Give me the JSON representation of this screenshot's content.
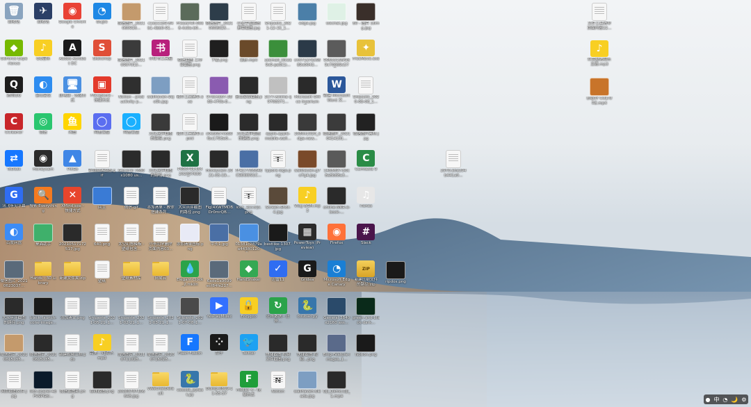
{
  "desktop": {
    "tray": [
      "●",
      "中",
      "◔",
      "🌙",
      "⚙"
    ],
    "icons": [
      {
        "label": "回收站",
        "color": "#8aa4bf",
        "glyph": "🗑",
        "kind": "app"
      },
      {
        "label": "回收站",
        "color": "#2b3f66",
        "glyph": "✈",
        "kind": "app"
      },
      {
        "label": "Google Chrome",
        "color": "#e94235",
        "glyph": "◉",
        "kind": "app"
      },
      {
        "label": "Bugle",
        "color": "#1e88e5",
        "glyph": "◔",
        "kind": "app"
      },
      {
        "label": "微信图片_2021060916...",
        "color": "#c49a6c",
        "glyph": "",
        "kind": "img"
      },
      {
        "label": "c1ea11b9-84b1-4bb0-91...",
        "color": "#f4f4f4",
        "glyph": "",
        "kind": "doc"
      },
      {
        "label": "Freeze!Dl-00e8-4c0e-b0...",
        "color": "#5b6b5a",
        "glyph": "",
        "kind": "img"
      },
      {
        "label": "微信图片_20210608025...",
        "color": "#2d3d4a",
        "glyph": "",
        "kind": "img"
      },
      {
        "label": "小米手机截图 屏幕截图.jpg",
        "color": "#f4f4f4",
        "glyph": "",
        "kind": "doc"
      },
      {
        "label": "Snipaste_2021-12-15_1...",
        "color": "#f0f0f0",
        "glyph": "",
        "kind": "doc"
      },
      {
        "label": "edge.jpg",
        "color": "#4b7fa8",
        "glyph": "",
        "kind": "img"
      },
      {
        "label": "wechat.jpg",
        "color": "#dff1e6",
        "glyph": "",
        "kind": "img"
      },
      {
        "label": "80 - 图片 (dimg.jpg",
        "color": "#3a2f2a",
        "glyph": "",
        "kind": "img"
      },
      {
        "label": "GeForce Experience",
        "color": "#76b900",
        "glyph": "◆",
        "kind": "app"
      },
      {
        "label": "QQ音乐",
        "color": "#f8cf23",
        "glyph": "♪",
        "kind": "app"
      },
      {
        "label": "Adobe Acrobat DC",
        "color": "#1a1a1a",
        "glyph": "A",
        "kind": "app"
      },
      {
        "label": "SketchUp",
        "color": "#e04f38",
        "glyph": "S",
        "kind": "app"
      },
      {
        "label": "微信图片_20210907015...",
        "color": "#3b3b3b",
        "glyph": "",
        "kind": "img"
      },
      {
        "label": "小红书工具箱",
        "color": "#b8207c",
        "glyph": "书",
        "kind": "app"
      },
      {
        "label": "微信截图 工作台截图.png",
        "color": "#f4f4f4",
        "glyph": "",
        "kind": "doc"
      },
      {
        "label": "下载.png",
        "color": "#1f1f1f",
        "glyph": "",
        "kind": "img"
      },
      {
        "label": "录屏.mp4",
        "color": "#6a4a2a",
        "glyph": "",
        "kind": "img"
      },
      {
        "label": "usemail_lkk3a9c9-pa0(1)...",
        "color": "#3b8f3b",
        "glyph": "",
        "kind": "img"
      },
      {
        "label": "c4471a7ac6889c0043...",
        "color": "#2b3a48",
        "glyph": "",
        "kind": "img"
      },
      {
        "label": "90653158f9d9c70089c573...",
        "color": "#5b5b5b",
        "glyph": "",
        "kind": "img"
      },
      {
        "label": "FreeMove.exe",
        "color": "#e8c23a",
        "glyph": "✦",
        "kind": "app"
      },
      {
        "label": "腾讯QQ",
        "color": "#1d1d1d",
        "glyph": "Q",
        "kind": "app"
      },
      {
        "label": "金山会议",
        "color": "#2d8cf0",
        "glyph": "◐",
        "kind": "app"
      },
      {
        "label": "此电脑 - 快捷方式",
        "color": "#4a90e2",
        "glyph": "🖥",
        "kind": "app"
      },
      {
        "label": "FSCapture - 快捷方式",
        "color": "#e33a2b",
        "glyph": "▣",
        "kind": "app"
      },
      {
        "label": "Notion - productivity p...",
        "color": "#2f2f2f",
        "glyph": "",
        "kind": "img"
      },
      {
        "label": "wallhaven-9ejo9k.jpg",
        "color": "#7d9ec2",
        "glyph": "",
        "kind": "img"
      },
      {
        "label": "软件工具清单.exe",
        "color": "#f4f4f4",
        "glyph": "",
        "kind": "doc"
      },
      {
        "label": "97dc4a67-3888-470b-8...",
        "color": "#8a5bb0",
        "glyph": "",
        "kind": "img"
      },
      {
        "label": "金山会议截图.png",
        "color": "#2a2a2a",
        "glyph": "",
        "kind": "img"
      },
      {
        "label": "3c77-Anima q9708371...",
        "color": "#c0c0c0",
        "glyph": "",
        "kind": "img"
      },
      {
        "label": "Microsoft Office Inserium 6...",
        "color": "#2a2a2a",
        "glyph": "",
        "kind": "img"
      },
      {
        "label": "新建 Microsoft Word 文...",
        "color": "#2b579a",
        "glyph": "W",
        "kind": "app"
      },
      {
        "label": "Snipaste_2020-08-08_1...",
        "color": "#f0f0f0",
        "glyph": "",
        "kind": "doc"
      },
      {
        "label": "CCleaner",
        "color": "#c8262a",
        "glyph": "C",
        "kind": "app"
      },
      {
        "label": "微信",
        "color": "#2ac66f",
        "glyph": "◎",
        "kind": "app"
      },
      {
        "label": "闲鱼",
        "color": "#ffd500",
        "glyph": "鱼",
        "kind": "app"
      },
      {
        "label": "阿里云盘",
        "color": "#5b6ef0",
        "glyph": "◯",
        "kind": "app"
      },
      {
        "label": "阿里云盘",
        "color": "#1ab0ff",
        "glyph": "◯",
        "kind": "app"
      },
      {
        "label": "大众点评截图 的路径.png",
        "color": "#3a3a3a",
        "glyph": "",
        "kind": "img"
      },
      {
        "label": "软件工具清单.xpml",
        "color": "#f4f4f4",
        "glyph": "",
        "kind": "doc"
      },
      {
        "label": "c0ed057c6d0fbc1793e0...",
        "color": "#1a1a1a",
        "glyph": "",
        "kind": "img"
      },
      {
        "label": "大众点评截图 的路径.png",
        "color": "#2b2b2b",
        "glyph": "",
        "kind": "img"
      },
      {
        "label": "apple-apple-mobile-wall...",
        "color": "#2a2a2a",
        "glyph": "",
        "kind": "img"
      },
      {
        "label": "1080x1920_edge-new...",
        "color": "#3a3a3a",
        "glyph": "",
        "kind": "img"
      },
      {
        "label": "微信图片_20210414101...",
        "color": "#3b3b3b",
        "glyph": "",
        "kind": "img"
      },
      {
        "label": "微信图片素材.jpg",
        "color": "#222",
        "glyph": "",
        "kind": "img"
      },
      {
        "label": "ToDesk",
        "color": "#1677ff",
        "glyph": "⇄",
        "kind": "app"
      },
      {
        "label": "Honeycam",
        "color": "#2b2b2b",
        "glyph": "◉",
        "kind": "app"
      },
      {
        "label": "PicGo",
        "color": "#3f86e6",
        "glyph": "▲",
        "kind": "app"
      },
      {
        "label": "新浪微博截图.gif",
        "color": "#f4f4f4",
        "glyph": "",
        "kind": "doc"
      },
      {
        "label": "General 7680x1080 us...",
        "color": "#2b2b2b",
        "glyph": "",
        "kind": "img"
      },
      {
        "label": "大众点评截图 的路径.png",
        "color": "#2a2a2a",
        "glyph": "",
        "kind": "img"
      },
      {
        "label": "P000791434 2028976594...",
        "color": "#1f7244",
        "glyph": "X",
        "kind": "app"
      },
      {
        "label": "Honeycam 2021-03-19...",
        "color": "#2a2a2a",
        "glyph": "",
        "kind": "img"
      },
      {
        "label": "7F4177D5846C9DDD91C...",
        "color": "#4a6fa5",
        "glyph": "",
        "kind": "img"
      },
      {
        "label": "typora logo.png",
        "color": "#f4f4f4",
        "glyph": "T",
        "kind": "doc"
      },
      {
        "label": "wallhaven-g7o7g4.jpg",
        "color": "#7a4a2a",
        "glyph": "",
        "kind": "img"
      },
      {
        "label": "1485897-b0c8a8b88a3...",
        "color": "#5a5a5a",
        "glyph": "",
        "kind": "img"
      },
      {
        "label": "Camtasia 9",
        "color": "#2a8c46",
        "glyph": "C",
        "kind": "app"
      },
      {
        "label": "讯飞听见字幕",
        "color": "#2f6df2",
        "glyph": "G",
        "kind": "app"
      },
      {
        "label": "搜索 Everything",
        "color": "#f47a20",
        "glyph": "🔍",
        "kind": "app"
      },
      {
        "label": "XMind.exe - 快捷方式",
        "color": "#e8452c",
        "glyph": "✕",
        "kind": "app"
      },
      {
        "label": "回主",
        "color": "#3a7bd5",
        "glyph": "",
        "kind": "img"
      },
      {
        "label": "微信.gif",
        "color": "#f4f4f4",
        "glyph": "",
        "kind": "doc"
      },
      {
        "label": "添加清单 - 教你搭建系列...",
        "color": "#f4f4f4",
        "glyph": "",
        "kind": "doc"
      },
      {
        "label": "大众点评截图 的路径.png",
        "color": "#2a2a2a",
        "glyph": "",
        "kind": "img"
      },
      {
        "label": "Fig(4XWTMDBDr0mrQB...",
        "color": "#f4f4f4",
        "glyph": "",
        "kind": "doc"
      },
      {
        "label": "icon_2[3.8]3.png",
        "color": "#e0e0e0",
        "glyph": "T",
        "kind": "doc"
      },
      {
        "label": "Screen-Shot-4.jpg",
        "color": "#5a4a3a",
        "glyph": "",
        "kind": "img"
      },
      {
        "label": "Vlog BGM.mp3",
        "color": "#f8cf23",
        "glyph": "♪",
        "kind": "app"
      },
      {
        "label": "online-MKR-e-book-...",
        "color": "#2a2a2a",
        "glyph": "",
        "kind": "img"
      },
      {
        "label": "iTunes",
        "color": "#e7e7e7",
        "glyph": "♫",
        "kind": "app"
      },
      {
        "label": "百度网盘",
        "color": "#3d8cf5",
        "glyph": "◐",
        "kind": "app"
      },
      {
        "label": "桌面助手",
        "color": "#3fb06b",
        "glyph": "",
        "kind": "img"
      },
      {
        "label": "20210517172517.jpg",
        "color": "#2a2a2a",
        "glyph": "",
        "kind": "img"
      },
      {
        "label": "640.png",
        "color": "#f4f4f4",
        "glyph": "",
        "kind": "doc"
      },
      {
        "label": "太空幻想模板 - 壁纸包含...",
        "color": "#f4f4f4",
        "glyph": "",
        "kind": "doc"
      },
      {
        "label": "小李同学删除 页面内容03...",
        "color": "#f4f4f4",
        "glyph": "",
        "kind": "doc"
      },
      {
        "label": "添加清单图标.png",
        "color": "#e8eaf6",
        "glyph": "",
        "kind": "img"
      },
      {
        "label": "中长1.jpg",
        "color": "#4a6fa5",
        "glyph": "",
        "kind": "img"
      },
      {
        "label": "01381c2879aa443801200...",
        "color": "#4a90e2",
        "glyph": "",
        "kind": "img"
      },
      {
        "label": "bestlike-1307.jpg",
        "color": "#1a1a1a",
        "glyph": "",
        "kind": "img"
      },
      {
        "label": "PowerToys (Preview)",
        "color": "#2b2b2b",
        "glyph": "▦",
        "kind": "app"
      },
      {
        "label": "Firefox",
        "color": "#ff7139",
        "glyph": "◉",
        "kind": "app"
      },
      {
        "label": "Slack",
        "color": "#4a154b",
        "glyph": "#",
        "kind": "app"
      },
      {
        "label": "微信图片_20210623037...",
        "color": "#5a6a7a",
        "glyph": "",
        "kind": "img"
      },
      {
        "label": "Hands - 3D Library",
        "color": "#e8c23a",
        "glyph": "",
        "kind": "folder"
      },
      {
        "label": "新建文件夹.zip",
        "color": "#e8c23a",
        "glyph": "",
        "kind": "folder"
      },
      {
        "label": "壁纸",
        "color": "#f4f4f4",
        "glyph": "",
        "kind": "doc"
      },
      {
        "label": "壁纸素材库",
        "color": "#e8c23a",
        "glyph": "",
        "kind": "folder"
      },
      {
        "label": "网易云",
        "color": "#e8c23a",
        "glyph": "",
        "kind": "folder"
      },
      {
        "label": "Elegant Clock_2.mklin",
        "color": "#2ba34a",
        "glyph": "💧",
        "kind": "app"
      },
      {
        "label": "6ade1a9699 ecf84fe217...",
        "color": "#5a6a7a",
        "glyph": "",
        "kind": "img"
      },
      {
        "label": "HandShaker",
        "color": "#34a853",
        "glyph": "◆",
        "kind": "app"
      },
      {
        "label": "迅雷11",
        "color": "#2f6df2",
        "glyph": "✓",
        "kind": "app"
      },
      {
        "label": "Gridea",
        "color": "#1a1a1a",
        "glyph": "G",
        "kind": "app"
      },
      {
        "label": "Microsoft Edge Canary",
        "color": "#1a7fd5",
        "glyph": "◔",
        "kind": "app"
      },
      {
        "label": "新建压缩文件 的路径.zip",
        "color": "#e8b030",
        "glyph": "",
        "kind": "zip"
      },
      {
        "label": "大众点评截图 的路径.png",
        "color": "#2a2a2a",
        "glyph": "",
        "kind": "img"
      },
      {
        "label": "black_launch-cone-image...",
        "color": "#1a1a1a",
        "glyph": "",
        "kind": "img"
      },
      {
        "label": "添加清单.png",
        "color": "#f4f4f4",
        "glyph": "",
        "kind": "doc"
      },
      {
        "label": "Snipaste_2021-05-21_1...",
        "color": "#f4f4f4",
        "glyph": "",
        "kind": "doc"
      },
      {
        "label": "Snipaste_2021-02-21_1...",
        "color": "#f4f4f4",
        "glyph": "",
        "kind": "doc"
      },
      {
        "label": "Snipaste_2021-03-21_1...",
        "color": "#f4f4f4",
        "glyph": "",
        "kind": "doc"
      },
      {
        "label": "Snipaste_2021-07-08_1...",
        "color": "#4a4a4a",
        "glyph": "",
        "kind": "img"
      },
      {
        "label": "YesPlayMusic",
        "color": "#3370ff",
        "glyph": "▶",
        "kind": "app"
      },
      {
        "label": "Encypto",
        "color": "#f8cf23",
        "glyph": "🔒",
        "kind": "app"
      },
      {
        "label": "迁移数据 - 迁移...",
        "color": "#2ba34a",
        "glyph": "↻",
        "kind": "app"
      },
      {
        "label": "doubao.py",
        "color": "#3776ab",
        "glyph": "🐍",
        "kind": "app"
      },
      {
        "label": "General 3840x2160 ass...",
        "color": "#2a4a6a",
        "glyph": "",
        "kind": "img"
      },
      {
        "label": "green-and-black-dark...",
        "color": "#0a2a1a",
        "glyph": "",
        "kind": "img"
      },
      {
        "label": "微信图片_20210615135...",
        "color": "#c49a6c",
        "glyph": "",
        "kind": "img"
      },
      {
        "label": "微信图片_20210615135...",
        "color": "#2a2a2a",
        "glyph": "",
        "kind": "img"
      },
      {
        "label": "新建视频工程.pdx",
        "color": "#f4f4f4",
        "glyph": "",
        "kind": "doc"
      },
      {
        "label": "完美 - 刘明华.mp3",
        "color": "#f8cf23",
        "glyph": "♪",
        "kind": "app"
      },
      {
        "label": "微信图片_20210711028...",
        "color": "#f4f4f4",
        "glyph": "",
        "kind": "doc"
      },
      {
        "label": "微信图片_20200716028...",
        "color": "#f4f4f4",
        "glyph": "",
        "kind": "doc"
      },
      {
        "label": "Flash Fusion",
        "color": "#1677ff",
        "glyph": "F",
        "kind": "app"
      },
      {
        "label": "扣子",
        "color": "#1a1a1a",
        "glyph": "⁘",
        "kind": "app"
      },
      {
        "label": "Twitter",
        "color": "#1da1f2",
        "glyph": "🐦",
        "kind": "app"
      },
      {
        "label": "快捷截图 视频文件截图.png",
        "color": "#2a2a2a",
        "glyph": "",
        "kind": "img"
      },
      {
        "label": "快捷截图 视频...png",
        "color": "#2a2a2a",
        "glyph": "",
        "kind": "img"
      },
      {
        "label": "Blog-Feature-Images_1...",
        "color": "#5a6a8a",
        "glyph": "",
        "kind": "img"
      },
      {
        "label": "Notion.png",
        "color": "#1a1a1a",
        "glyph": "",
        "kind": "img"
      },
      {
        "label": "网页截图文件.jpg",
        "color": "#f4f4f4",
        "glyph": "",
        "kind": "doc"
      },
      {
        "label": "lion-soarer-4bFV9PGbl...",
        "color": "#0a1a2a",
        "glyph": "",
        "kind": "img"
      },
      {
        "label": "微信截图新.png",
        "color": "#f4f4f4",
        "glyph": "",
        "kind": "doc"
      },
      {
        "label": "在线截图.png",
        "color": "#2a2a2a",
        "glyph": "",
        "kind": "img"
      },
      {
        "label": "20200707106648.jpg",
        "color": "#f4f4f4",
        "glyph": "",
        "kind": "doc"
      },
      {
        "label": "vWeChatDefault",
        "color": "#e8c23a",
        "glyph": "",
        "kind": "folder"
      },
      {
        "label": "vscode_pytest.py",
        "color": "#3776ab",
        "glyph": "🐍",
        "kind": "app"
      },
      {
        "label": "Dump-0819-11-55-57",
        "color": "#e8c23a",
        "glyph": "",
        "kind": "folder"
      },
      {
        "label": "Fiddler 4 - 快捷方式",
        "color": "#1f9e3a",
        "glyph": "F",
        "kind": "app"
      },
      {
        "label": "Notion",
        "color": "#f4f4f4",
        "glyph": "N",
        "kind": "doc"
      },
      {
        "label": "wallhaven-6ieada.jpg",
        "color": "#7d9ec2",
        "glyph": "",
        "kind": "img"
      },
      {
        "label": "DJI_Osmo-DJI_1.mp4",
        "color": "#2a2a2a",
        "glyph": "",
        "kind": "img"
      },
      {
        "label": "文件工具清单 页面内容22...",
        "color": "#f4f4f4",
        "glyph": "",
        "kind": "doc"
      },
      {
        "label": "红色精选音乐 主题.mp3",
        "color": "#f8cf23",
        "glyph": "♪",
        "kind": "app"
      },
      {
        "label": "ENJOY CULTURE.mp4",
        "color": "#c8742a",
        "glyph": "",
        "kind": "img"
      },
      {
        "label": "2970.eba294b441a0...",
        "color": "#f4f4f4",
        "glyph": "",
        "kind": "doc"
      },
      {
        "label": "ripdos.png",
        "color": "#1a1a1a",
        "glyph": "",
        "kind": "img"
      }
    ]
  }
}
